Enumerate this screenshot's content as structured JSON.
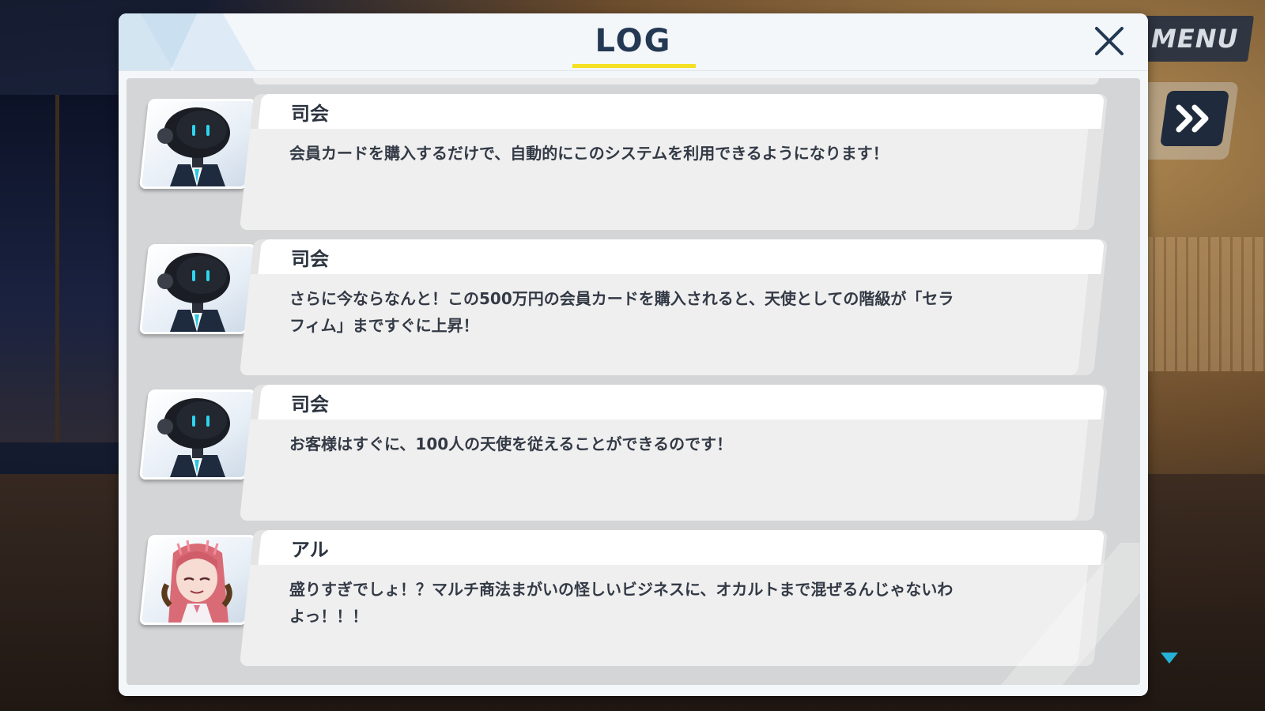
{
  "hud": {
    "menu_label": "MENU"
  },
  "log": {
    "title": "LOG",
    "entries": [
      {
        "speaker": "司会",
        "portrait": "robot-host-icon",
        "lines": [
          "会員カードを購入するだけで、自動的にこのシステムを利用できるようになります！"
        ]
      },
      {
        "speaker": "司会",
        "portrait": "robot-host-icon",
        "lines": [
          "さらに今ならなんと！この500万円の会員カードを購入されると、天使としての階級が「セラ",
          "フィム」まですぐに上昇！"
        ]
      },
      {
        "speaker": "司会",
        "portrait": "robot-host-icon",
        "lines": [
          "お客様はすぐに、100人の天使を従えることができるのです！"
        ]
      },
      {
        "speaker": "アル",
        "portrait": "aru-portrait",
        "lines": [
          "盛りすぎでしょ！？マルチ商法まがいの怪しいビジネスに、オカルトまで混ぜるんじゃないわ",
          "よっ！！！"
        ]
      }
    ]
  },
  "colors": {
    "title": "#233853",
    "title_underline": "#f4e024",
    "menu_button": "#2f3541",
    "scroll_arrow": "#27b0d6"
  }
}
